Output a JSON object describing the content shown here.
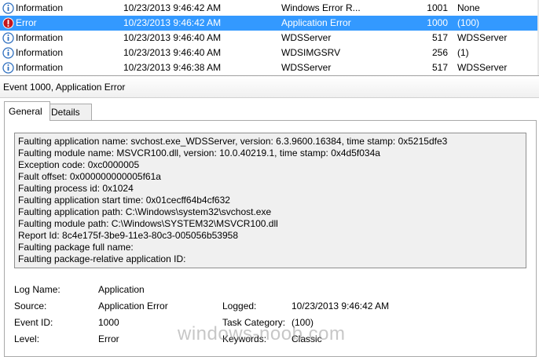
{
  "event_list": {
    "rows": [
      {
        "level_icon": "information-icon",
        "level": "Information",
        "date": "10/23/2013 9:46:42 AM",
        "source": "Windows Error R...",
        "event_id": "1001",
        "task": "None",
        "selected": false
      },
      {
        "level_icon": "error-icon",
        "level": "Error",
        "date": "10/23/2013 9:46:42 AM",
        "source": "Application Error",
        "event_id": "1000",
        "task": "(100)",
        "selected": true
      },
      {
        "level_icon": "information-icon",
        "level": "Information",
        "date": "10/23/2013 9:46:40 AM",
        "source": "WDSServer",
        "event_id": "517",
        "task": "WDSServer",
        "selected": false
      },
      {
        "level_icon": "information-icon",
        "level": "Information",
        "date": "10/23/2013 9:46:40 AM",
        "source": "WDSIMGSRV",
        "event_id": "256",
        "task": "(1)",
        "selected": false
      },
      {
        "level_icon": "information-icon",
        "level": "Information",
        "date": "10/23/2013 9:46:38 AM",
        "source": "WDSServer",
        "event_id": "517",
        "task": "WDSServer",
        "selected": false
      }
    ]
  },
  "detail": {
    "title": "Event 1000, Application Error",
    "tabs": [
      {
        "label": "General",
        "active": true
      },
      {
        "label": "Details",
        "active": false
      }
    ],
    "description_lines": [
      "Faulting application name: svchost.exe_WDSServer, version: 6.3.9600.16384, time stamp: 0x5215dfe3",
      "Faulting module name: MSVCR100.dll, version: 10.0.40219.1, time stamp: 0x4d5f034a",
      "Exception code: 0xc0000005",
      "Fault offset: 0x000000000005f61a",
      "Faulting process id: 0x1024",
      "Faulting application start time: 0x01cecff64b4cf632",
      "Faulting application path: C:\\Windows\\system32\\svchost.exe",
      "Faulting module path: C:\\Windows\\SYSTEM32\\MSVCR100.dll",
      "Report Id: 8c4e175f-3be9-11e3-80c3-005056b53958",
      "Faulting package full name:",
      "Faulting package-relative application ID:"
    ],
    "properties": {
      "log_name_label": "Log Name:",
      "log_name_value": "Application",
      "source_label": "Source:",
      "source_value": "Application Error",
      "logged_label": "Logged:",
      "logged_value": "10/23/2013 9:46:42 AM",
      "event_id_label": "Event ID:",
      "event_id_value": "1000",
      "task_category_label": "Task Category:",
      "task_category_value": "(100)",
      "level_label": "Level:",
      "level_value": "Error",
      "keywords_label": "Keywords:",
      "keywords_value": "Classic"
    }
  },
  "watermark": "windows-noob.com",
  "colors": {
    "selection": "#3399ff",
    "info_icon": "#2e6fbf",
    "error_icon": "#c4161c"
  }
}
